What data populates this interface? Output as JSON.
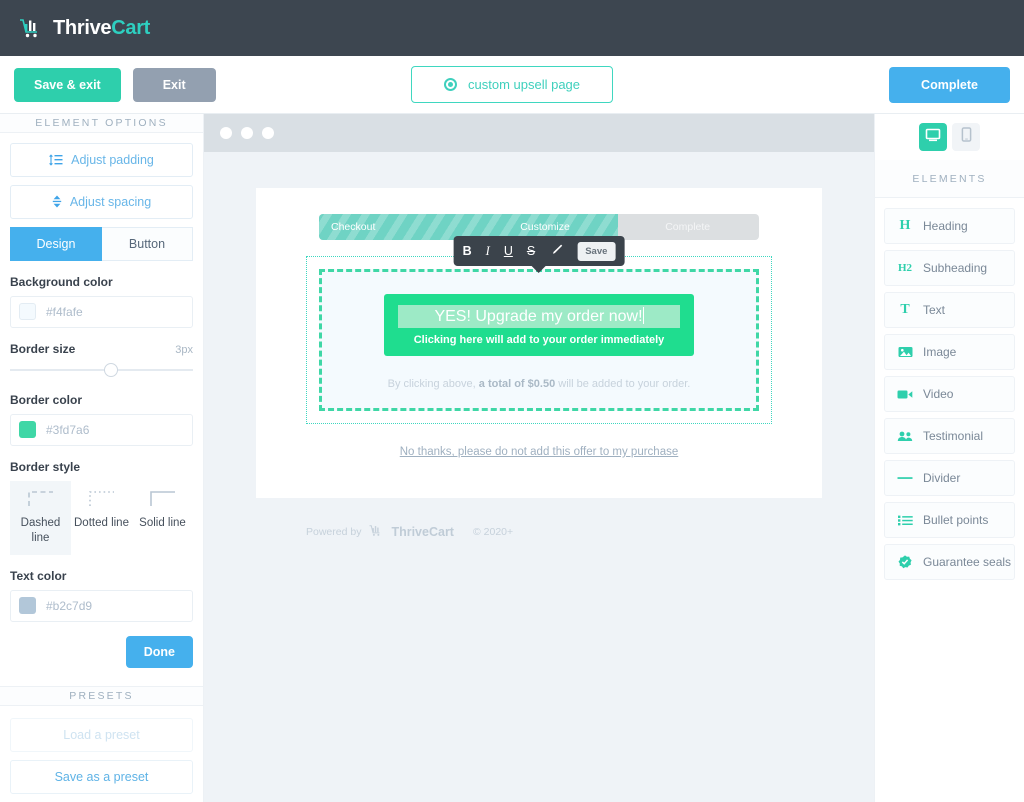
{
  "topbar": {
    "logo_thrive": "Thrive",
    "logo_cart": "Cart",
    "logo_icon": "cart-chart-icon"
  },
  "actionbar": {
    "save_exit_label": "Save & exit",
    "exit_label": "Exit",
    "page_pill_label": "custom upsell page",
    "page_pill_icon": "target-icon",
    "complete_label": "Complete"
  },
  "left_panel": {
    "header": "ELEMENT OPTIONS",
    "adjust_padding_label": "Adjust padding",
    "adjust_padding_icon": "list-padding-icon",
    "adjust_spacing_label": "Adjust spacing",
    "adjust_spacing_icon": "up-down-arrows-icon",
    "tabs": [
      {
        "label": "Design",
        "active": true
      },
      {
        "label": "Button",
        "active": false
      }
    ],
    "background_color": {
      "label": "Background color",
      "value": "#f4fafe",
      "swatch": "#f4fafe"
    },
    "border_size": {
      "label": "Border size",
      "value": "3px",
      "knob_percent": 55
    },
    "border_color": {
      "label": "Border color",
      "value": "#3fd7a6",
      "swatch": "#3fd7a6"
    },
    "border_style": {
      "label": "Border style",
      "options": [
        {
          "label": "Dashed line",
          "icon": "corner-dashed-icon",
          "selected": true
        },
        {
          "label": "Dotted line",
          "icon": "corner-dotted-icon",
          "selected": false
        },
        {
          "label": "Solid line",
          "icon": "corner-solid-icon",
          "selected": false
        }
      ]
    },
    "text_color": {
      "label": "Text color",
      "value": "#b2c7d9",
      "swatch": "#b2c7d9"
    },
    "done_label": "Done",
    "presets_header": "PRESETS",
    "load_preset_label": "Load a preset",
    "save_preset_label": "Save as a preset"
  },
  "canvas": {
    "progress": {
      "steps": [
        "Checkout",
        "Customize",
        "Complete"
      ],
      "fill_percent": 68
    },
    "toolbar": {
      "bold": "B",
      "italic": "I",
      "underline": "U",
      "strikethrough": "S",
      "highlighter_icon": "pencil-highlighter-icon",
      "save_label": "Save"
    },
    "cta": {
      "title": "YES! Upgrade my order now!",
      "subtitle": "Clicking here will add to your order immediately"
    },
    "fineprint_pre": "By clicking above, ",
    "fineprint_bold": "a total of $0.50",
    "fineprint_post": " will be added to your order.",
    "decline_link": "No thanks, please do not add this offer to my purchase",
    "footer": {
      "powered_by": "Powered by",
      "brand": "ThriveCart",
      "copyright": "© 2020+"
    }
  },
  "right_panel": {
    "devices": [
      {
        "name": "desktop",
        "icon": "desktop-icon",
        "active": true
      },
      {
        "name": "mobile",
        "icon": "mobile-icon",
        "active": false
      }
    ],
    "header": "ELEMENTS",
    "items": [
      {
        "label": "Heading",
        "icon": "heading-h-icon"
      },
      {
        "label": "Subheading",
        "icon": "subheading-h2-icon"
      },
      {
        "label": "Text",
        "icon": "text-t-icon"
      },
      {
        "label": "Image",
        "icon": "image-icon"
      },
      {
        "label": "Video",
        "icon": "video-camera-icon"
      },
      {
        "label": "Testimonial",
        "icon": "people-icon"
      },
      {
        "label": "Divider",
        "icon": "divider-line-icon"
      },
      {
        "label": "Bullet points",
        "icon": "bullet-list-icon"
      },
      {
        "label": "Guarantee seals",
        "icon": "seal-check-icon"
      }
    ]
  },
  "colors": {
    "brand_teal": "#2ecfac",
    "accent_blue": "#45b0ed",
    "dark_nav": "#3d4650",
    "cta_green": "#1fdd8f",
    "border_teal": "#3fd7a6"
  }
}
